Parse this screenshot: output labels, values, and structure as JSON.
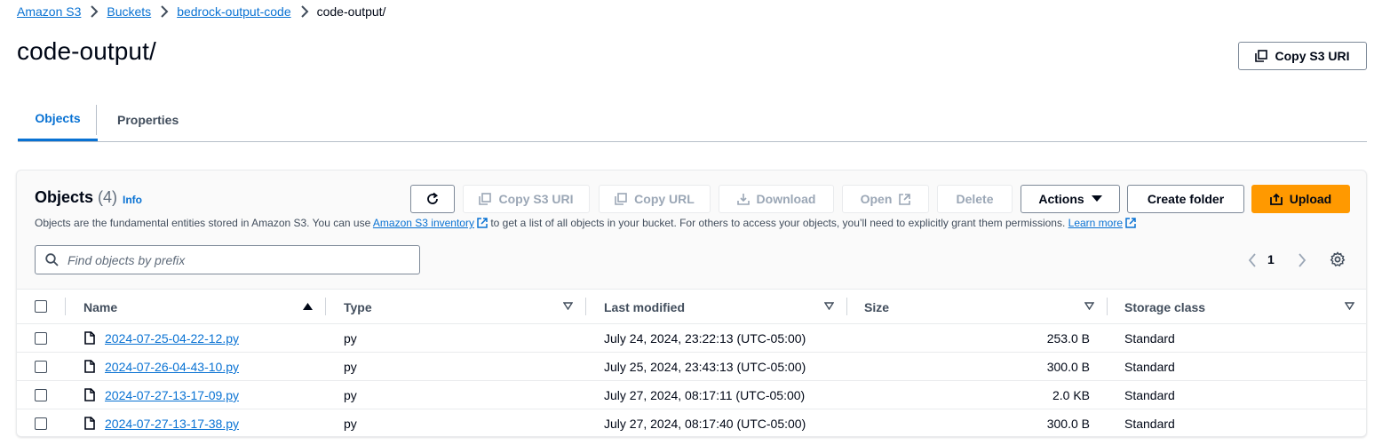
{
  "breadcrumb": {
    "items": [
      "Amazon S3",
      "Buckets",
      "bedrock-output-code"
    ],
    "current": "code-output/"
  },
  "page": {
    "title": "code-output/",
    "copy_s3_uri_label": "Copy S3 URI"
  },
  "tabs": [
    {
      "label": "Objects",
      "active": true
    },
    {
      "label": "Properties",
      "active": false
    }
  ],
  "objects_panel": {
    "title": "Objects",
    "count": "(4)",
    "info_label": "Info",
    "description_prefix": "Objects are the fundamental entities stored in Amazon S3. You can use",
    "inventory_link": "Amazon S3 inventory",
    "description_middle": "to get a list of all objects in your bucket. For others to access your objects, you’ll need to explicitly grant them permissions.",
    "learn_more": "Learn more",
    "search_placeholder": "Find objects by prefix",
    "page_number": "1",
    "toolbar": {
      "copy_s3_uri": "Copy S3 URI",
      "copy_url": "Copy URL",
      "download": "Download",
      "open": "Open",
      "delete": "Delete",
      "actions": "Actions",
      "create_folder": "Create folder",
      "upload": "Upload"
    },
    "columns": {
      "name": "Name",
      "type": "Type",
      "last_modified": "Last modified",
      "size": "Size",
      "storage_class": "Storage class"
    },
    "rows": [
      {
        "name": "2024-07-25-04-22-12.py",
        "type": "py",
        "last_modified": "July 24, 2024, 23:22:13 (UTC-05:00)",
        "size": "253.0 B",
        "storage_class": "Standard"
      },
      {
        "name": "2024-07-26-04-43-10.py",
        "type": "py",
        "last_modified": "July 25, 2024, 23:43:13 (UTC-05:00)",
        "size": "300.0 B",
        "storage_class": "Standard"
      },
      {
        "name": "2024-07-27-13-17-09.py",
        "type": "py",
        "last_modified": "July 27, 2024, 08:17:11 (UTC-05:00)",
        "size": "2.0 KB",
        "storage_class": "Standard"
      },
      {
        "name": "2024-07-27-13-17-38.py",
        "type": "py",
        "last_modified": "July 27, 2024, 08:17:40 (UTC-05:00)",
        "size": "300.0 B",
        "storage_class": "Standard"
      }
    ]
  },
  "colors": {
    "link": "#0972d3",
    "primary_button": "#ff9900",
    "text": "#000716",
    "disabled": "#9ba7b6"
  }
}
